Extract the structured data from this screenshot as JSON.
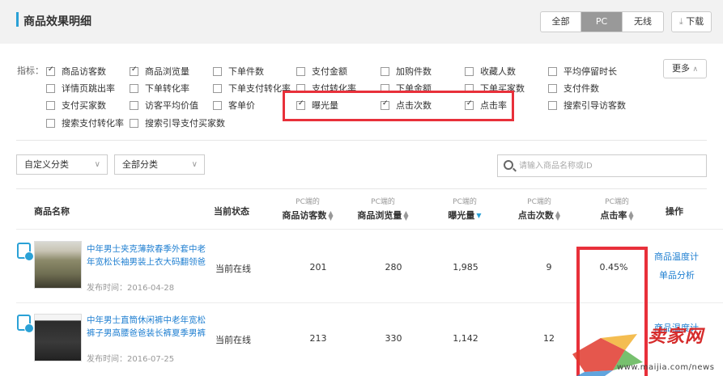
{
  "header": {
    "title": "商品效果明细",
    "segments": [
      "全部",
      "PC",
      "无线"
    ],
    "active_segment": "PC",
    "download_label": "下载"
  },
  "indicators": {
    "label": "指标：",
    "more_label": "更多",
    "items": [
      {
        "label": "商品访客数",
        "checked": true
      },
      {
        "label": "商品浏览量",
        "checked": true
      },
      {
        "label": "下单件数",
        "checked": false
      },
      {
        "label": "支付金额",
        "checked": false
      },
      {
        "label": "加购件数",
        "checked": false
      },
      {
        "label": "收藏人数",
        "checked": false
      },
      {
        "label": "平均停留时长",
        "checked": false
      },
      {
        "label": "详情页跳出率",
        "checked": false
      },
      {
        "label": "下单转化率",
        "checked": false
      },
      {
        "label": "下单支付转化率",
        "checked": false
      },
      {
        "label": "支付转化率",
        "checked": false
      },
      {
        "label": "下单金额",
        "checked": false
      },
      {
        "label": "下单买家数",
        "checked": false
      },
      {
        "label": "支付件数",
        "checked": false
      },
      {
        "label": "支付买家数",
        "checked": false
      },
      {
        "label": "访客平均价值",
        "checked": false
      },
      {
        "label": "客单价",
        "checked": false
      },
      {
        "label": "曝光量",
        "checked": true
      },
      {
        "label": "点击次数",
        "checked": true
      },
      {
        "label": "点击率",
        "checked": true
      },
      {
        "label": "搜索引导访客数",
        "checked": false
      },
      {
        "label": "搜索支付转化率",
        "checked": false
      },
      {
        "label": "搜索引导支付买家数",
        "checked": false
      }
    ]
  },
  "filters": {
    "category1": "自定义分类",
    "category2": "全部分类",
    "search_placeholder": "请输入商品名称或ID"
  },
  "table": {
    "col_name": "商品名称",
    "col_status": "当前状态",
    "col_ops": "操作",
    "metric_prefix": "PC端的",
    "metrics": [
      "商品访客数",
      "商品浏览量",
      "曝光量",
      "点击次数",
      "点击率"
    ],
    "rows": [
      {
        "title": "中年男士夹克薄款春季外套中老年宽松长袖男装上衣大码翻领爸",
        "date": "发布时间：2016-04-28",
        "status": "当前在线",
        "values": [
          "201",
          "280",
          "1,985",
          "9",
          "0.45%"
        ],
        "ops": [
          "商品温度计",
          "单品分析"
        ]
      },
      {
        "title": "中年男士直筒休闲裤中老年宽松裤子男高腰爸爸装长裤夏季男裤",
        "date": "发布时间：2016-07-25",
        "status": "当前在线",
        "values": [
          "213",
          "330",
          "1,142",
          "12",
          ""
        ],
        "ops": [
          "商品温度计"
        ]
      }
    ]
  },
  "watermark": {
    "text": "卖家网",
    "url": "www.maijia.com/news"
  }
}
